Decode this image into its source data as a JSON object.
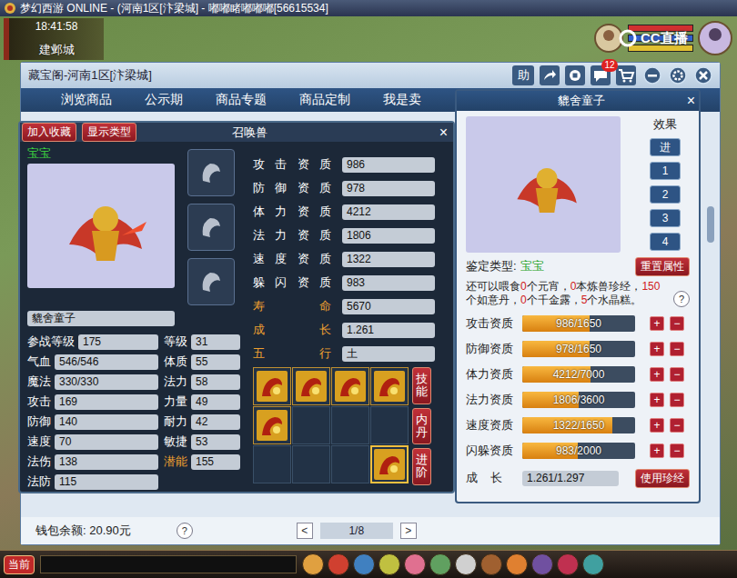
{
  "window": {
    "title": "梦幻西游 ONLINE - (河南1区[汴梁城] - 嘟嘟睹嘟嘟嘟[56615534]"
  },
  "hud": {
    "time": "18:41:58",
    "location": "建邺城",
    "watermark": "CC直播"
  },
  "store": {
    "title": "藏宝阁-河南1区[汴梁城]",
    "help": "助",
    "message_badge": "12",
    "tabs": [
      {
        "label": "浏览商品",
        "selected": false
      },
      {
        "label": "公示期",
        "selected": false
      },
      {
        "label": "商品专题",
        "selected": false
      },
      {
        "label": "商品定制",
        "selected": false
      },
      {
        "label": "我是卖",
        "selected": false
      }
    ],
    "wallet": "钱包余额: 20.90元",
    "wallet_help": "?",
    "pager": {
      "prev": "<",
      "page": "1/8",
      "next": ">"
    }
  },
  "pet_panel": {
    "buttons": [
      "加入收藏",
      "显示类型"
    ],
    "title": "召唤兽",
    "close": "×",
    "type": "宝宝",
    "name": "貔舍童子",
    "equipment_slots": [
      {
        "filled": false
      },
      {
        "filled": false
      },
      {
        "filled": false
      }
    ],
    "stats": [
      [
        {
          "label": "参战等级",
          "value": "175",
          "highlight": false
        },
        {
          "label": "等级",
          "value": "31",
          "highlight": false
        }
      ],
      [
        {
          "label": "气血",
          "value": "546/546",
          "highlight": false
        },
        {
          "label": "体质",
          "value": "55",
          "highlight": false
        }
      ],
      [
        {
          "label": "魔法",
          "value": "330/330",
          "highlight": false
        },
        {
          "label": "法力",
          "value": "58",
          "highlight": false
        }
      ],
      [
        {
          "label": "攻击",
          "value": "169",
          "highlight": false
        },
        {
          "label": "力量",
          "value": "49",
          "highlight": false
        }
      ],
      [
        {
          "label": "防御",
          "value": "140",
          "highlight": false
        },
        {
          "label": "耐力",
          "value": "42",
          "highlight": false
        }
      ],
      [
        {
          "label": "速度",
          "value": "70",
          "highlight": false
        },
        {
          "label": "敏捷",
          "value": "53",
          "highlight": false
        }
      ],
      [
        {
          "label": "法伤",
          "value": "138",
          "highlight": false
        },
        {
          "label": "潜能",
          "value": "155",
          "highlight": true
        }
      ],
      [
        {
          "label": "法防",
          "value": "115",
          "highlight": false
        }
      ]
    ],
    "attributes": [
      {
        "label": "攻击资质",
        "value": "986",
        "highlight": false
      },
      {
        "label": "防御资质",
        "value": "978",
        "highlight": false
      },
      {
        "label": "体力资质",
        "value": "4212",
        "highlight": false
      },
      {
        "label": "法力资质",
        "value": "1806",
        "highlight": false
      },
      {
        "label": "速度资质",
        "value": "1322",
        "highlight": false
      },
      {
        "label": "躲闪资质",
        "value": "983",
        "highlight": false
      },
      {
        "label": "寿命",
        "value": "5670",
        "highlight": true
      },
      {
        "label": "成长",
        "value": "1.261",
        "highlight": true
      },
      {
        "label": "五行",
        "value": "土",
        "highlight": true
      }
    ],
    "skills": [
      {
        "kind": "skill"
      },
      {
        "kind": "skill"
      },
      {
        "kind": "skill"
      },
      {
        "kind": "skill"
      },
      {
        "kind": "skill"
      },
      {
        "kind": "empty"
      },
      {
        "kind": "empty"
      },
      {
        "kind": "empty"
      },
      {
        "kind": "empty"
      },
      {
        "kind": "empty"
      },
      {
        "kind": "empty"
      },
      {
        "kind": "special"
      }
    ],
    "side_buttons": [
      "技能",
      "内丹",
      "进阶"
    ]
  },
  "appraisal": {
    "title": "貔舍童子",
    "close": "×",
    "effect_label": "效果",
    "effect_buttons": [
      "进",
      "1",
      "2",
      "3",
      "4"
    ],
    "type_label": "鉴定类型:",
    "type_value": "宝宝",
    "reset": "重置属性",
    "feed": [
      {
        "text": "还可以喂食",
        "highlight": false
      },
      {
        "text": "0",
        "highlight": true
      },
      {
        "text": "个元宵，",
        "highlight": false
      },
      {
        "text": "0",
        "highlight": true
      },
      {
        "text": "本炼兽珍经，",
        "highlight": false
      },
      {
        "text": "150",
        "highlight": true
      },
      {
        "text": "个如意丹，",
        "highlight": false
      },
      {
        "text": "0",
        "highlight": true
      },
      {
        "text": "个千金露，",
        "highlight": false
      },
      {
        "text": "5",
        "highlight": true
      },
      {
        "text": "个水晶糕。",
        "highlight": false
      }
    ],
    "help": "?",
    "plus": "+",
    "minus": "−",
    "bars": [
      {
        "label": "攻击资质",
        "reading": "986/1650",
        "level": 0.598
      },
      {
        "label": "防御资质",
        "reading": "978/1650",
        "level": 0.593
      },
      {
        "label": "体力资质",
        "reading": "4212/7000",
        "level": 0.602
      },
      {
        "label": "法力资质",
        "reading": "1806/3600",
        "level": 0.502
      },
      {
        "label": "速度资质",
        "reading": "1322/1650",
        "level": 0.801
      },
      {
        "label": "闪躲资质",
        "reading": "983/2000",
        "level": 0.492
      }
    ],
    "growth": {
      "label": "成长",
      "reading": "1.261/1.297"
    },
    "use_button": "使用珍经"
  },
  "taskbar": {
    "channel": "当前"
  }
}
